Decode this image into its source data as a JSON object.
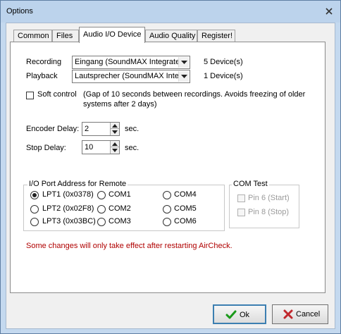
{
  "window": {
    "title": "Options"
  },
  "icons": {
    "close": "close-icon",
    "ok": "checkmark-icon",
    "cancel": "x-cross-icon"
  },
  "colors": {
    "notice": "#b00000",
    "ok_check": "#1a9a1a",
    "cancel_x": "#c0282d"
  },
  "tabs": [
    {
      "label": "Common",
      "active": false
    },
    {
      "label": "Files",
      "active": false
    },
    {
      "label": "Audio I/O Device",
      "active": true
    },
    {
      "label": "Audio Quality",
      "active": false
    },
    {
      "label": "Register!",
      "active": false
    }
  ],
  "audio": {
    "recording_label": "Recording",
    "recording_value": "Eingang (SoundMAX Integrated",
    "recording_count": "5 Device(s)",
    "playback_label": "Playback",
    "playback_value": "Lautsprecher (SoundMAX Integ",
    "playback_count": "1 Device(s)"
  },
  "soft_control": {
    "label": "Soft control",
    "checked": false,
    "description_line1": "(Gap of 10 seconds between recordings. Avoids freezing of older",
    "description_line2": "systems after 2 days)"
  },
  "encoder_delay": {
    "label": "Encoder Delay:",
    "value": "2",
    "unit": "sec."
  },
  "stop_delay": {
    "label": "Stop Delay:",
    "value": "10",
    "unit": "sec."
  },
  "io_port": {
    "legend": "I/O Port Address for Remote",
    "options": {
      "lpt1": "LPT1 (0x0378)",
      "lpt2": "LPT2 (0x02F8)",
      "lpt3": "LPT3 (0x03BC)",
      "com1": "COM1",
      "com2": "COM2",
      "com3": "COM3",
      "com4": "COM4",
      "com5": "COM5",
      "com6": "COM6"
    },
    "selected": "LPT1 (0x0378)"
  },
  "com_test": {
    "legend": "COM Test",
    "pin6": "Pin 6 (Start)",
    "pin8": "Pin 8 (Stop)"
  },
  "notice": "Some changes will only take effect after restarting AirCheck.",
  "buttons": {
    "ok": "Ok",
    "cancel": "Cancel"
  }
}
